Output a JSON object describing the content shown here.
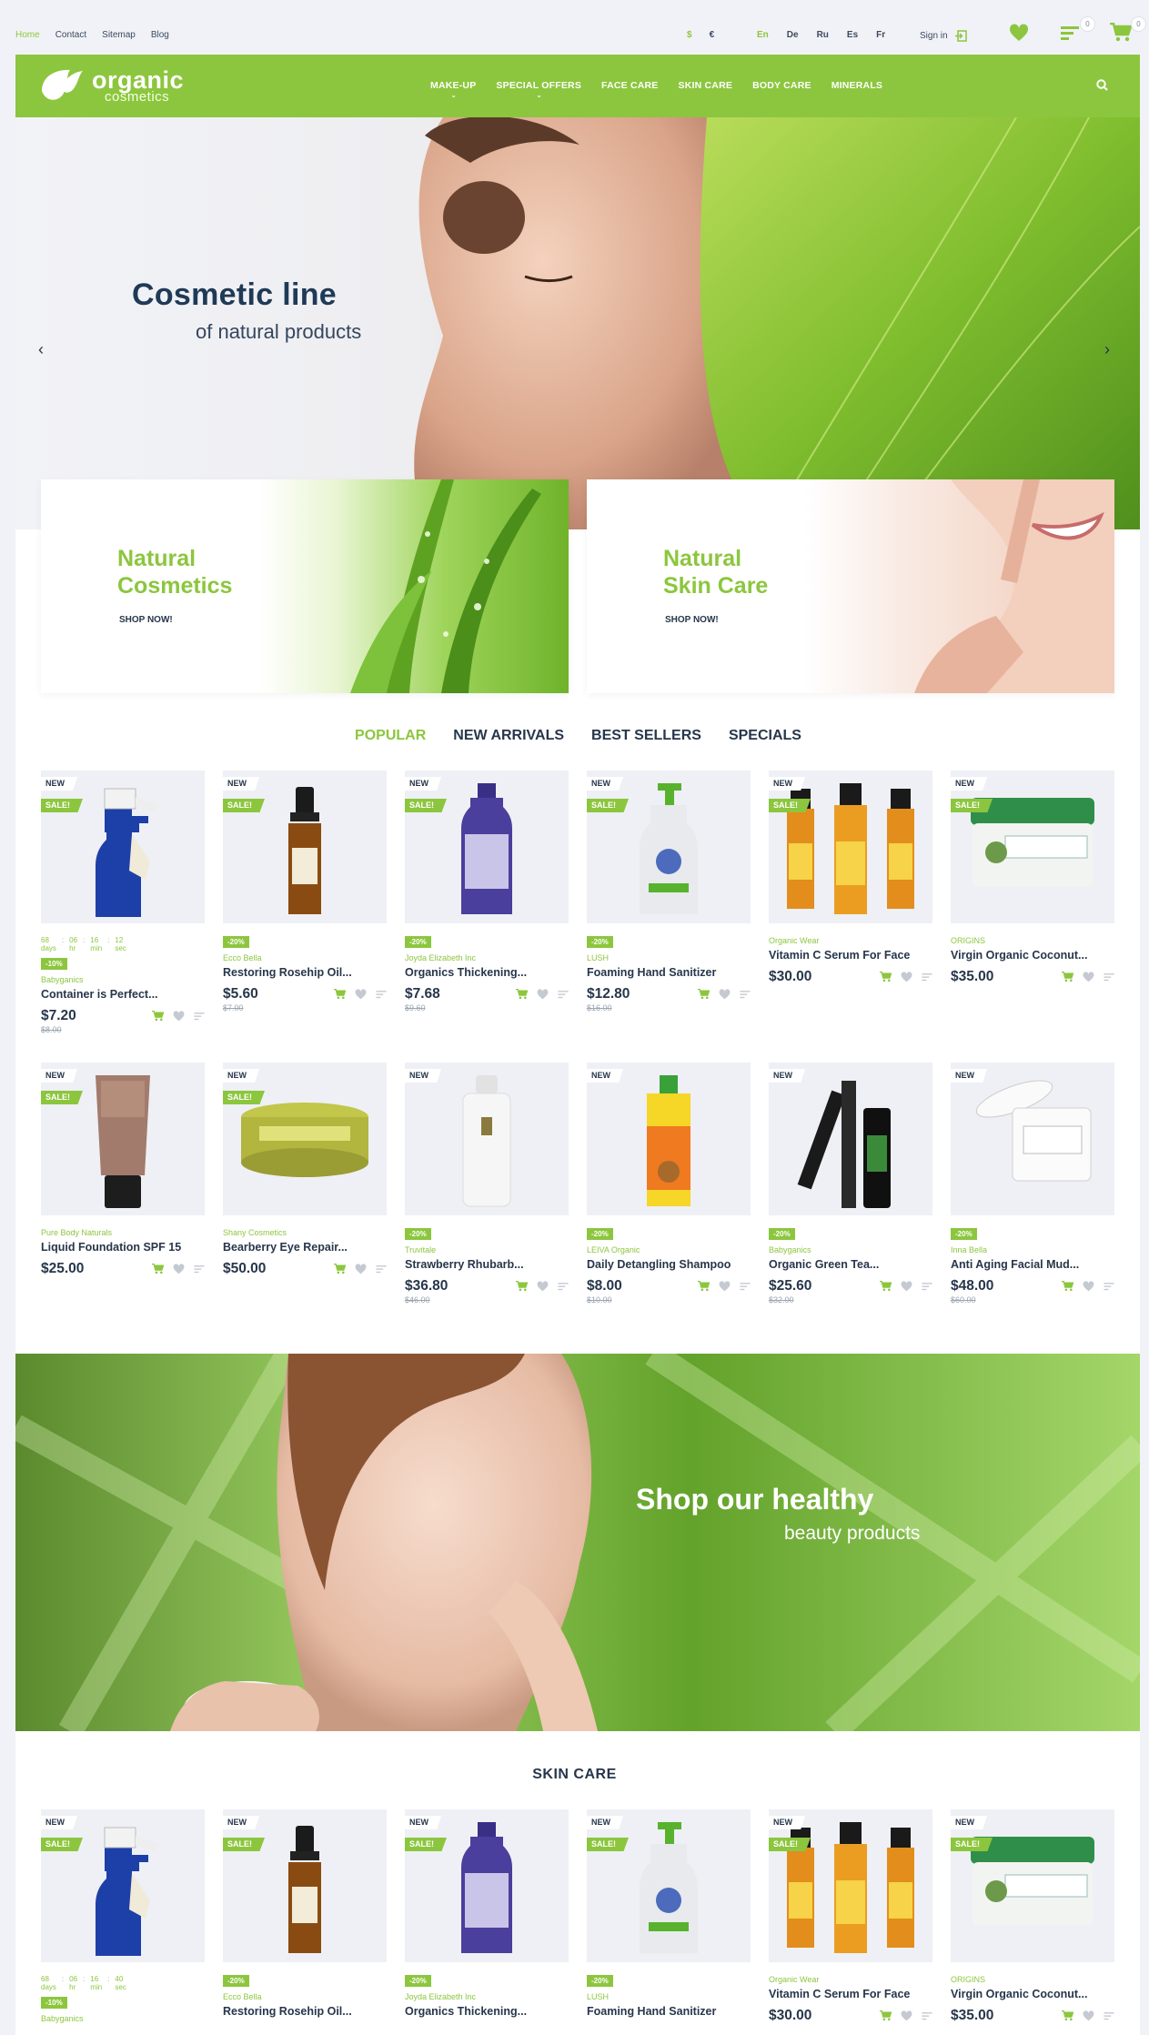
{
  "top_links": [
    "Home",
    "Contact",
    "Sitemap",
    "Blog"
  ],
  "currencies": [
    "$",
    "€"
  ],
  "languages": [
    "En",
    "De",
    "Ru",
    "Es",
    "Fr"
  ],
  "signin": "Sign in",
  "wishlist_count": "",
  "compare_count": "0",
  "cart_count": "0",
  "logo": {
    "line1": "organic",
    "line2": "cosmetics"
  },
  "menu": [
    "MAKE-UP",
    "SPECIAL OFFERS",
    "FACE CARE",
    "SKIN CARE",
    "BODY CARE",
    "MINERALS"
  ],
  "hero": {
    "title": "Cosmetic line",
    "subtitle": "of natural products"
  },
  "banners": [
    {
      "title": "Natural\nCosmetics",
      "cta": "SHOP NOW!"
    },
    {
      "title": "Natural\nSkin Care",
      "cta": "SHOP NOW!"
    }
  ],
  "tabs": [
    "POPULAR",
    "NEW ARRIVALS",
    "BEST SELLERS",
    "SPECIALS"
  ],
  "timer": {
    "days": "68",
    "hours": "06",
    "min": "16",
    "sec": "12",
    "days_label": "days",
    "hours_label": "hr",
    "min_label": "min",
    "sec_label": "sec"
  },
  "timer2": {
    "days": "68",
    "hours": "06",
    "min": "16",
    "sec": "40"
  },
  "products_row1": [
    {
      "brand": "Babyganics",
      "name": "Container is Perfect...",
      "price": "$7.20",
      "old": "$8.00",
      "disc": "-10%",
      "sale": true,
      "timer": true,
      "kind": "spray"
    },
    {
      "brand": "Ecco Bella",
      "name": "Restoring Rosehip Oil...",
      "price": "$5.60",
      "old": "$7.00",
      "disc": "-20%",
      "sale": true,
      "kind": "dropper"
    },
    {
      "brand": "Joyda Elizabeth Inc",
      "name": "Organics Thickening...",
      "price": "$7.68",
      "old": "$9.60",
      "disc": "-20%",
      "sale": true,
      "kind": "shampoo"
    },
    {
      "brand": "LUSH",
      "name": "Foaming Hand Sanitizer",
      "price": "$12.80",
      "old": "$16.00",
      "disc": "-20%",
      "sale": true,
      "kind": "pump"
    },
    {
      "brand": "Organic Wear",
      "name": "Vitamin C Serum For Face",
      "price": "$30.00",
      "old": "",
      "disc": "",
      "sale": true,
      "kind": "serum"
    },
    {
      "brand": "ORIGINS",
      "name": "Virgin Organic Coconut...",
      "price": "$35.00",
      "old": "",
      "disc": "",
      "sale": true,
      "kind": "jar"
    }
  ],
  "products_row2": [
    {
      "brand": "Pure Body Naturals",
      "name": "Liquid Foundation SPF 15",
      "price": "$25.00",
      "old": "",
      "disc": "",
      "sale": true,
      "kind": "tube"
    },
    {
      "brand": "Shany Cosmetics",
      "name": "Bearberry Eye Repair...",
      "price": "$50.00",
      "old": "",
      "disc": "",
      "sale": true,
      "kind": "tin"
    },
    {
      "brand": "Truvitale",
      "name": "Strawberry Rhubarb...",
      "price": "$36.80",
      "old": "$46.00",
      "disc": "-20%",
      "sale": false,
      "kind": "lotion"
    },
    {
      "brand": "LEIVA Organic",
      "name": "Daily Detangling Shampoo",
      "price": "$8.00",
      "old": "$10.00",
      "disc": "-20%",
      "sale": false,
      "kind": "kids"
    },
    {
      "brand": "Babyganics",
      "name": "Organic Green Tea...",
      "price": "$25.60",
      "old": "$32.00",
      "disc": "-20%",
      "sale": false,
      "kind": "mascara"
    },
    {
      "brand": "Inna Bella",
      "name": "Anti Aging Facial Mud...",
      "price": "$48.00",
      "old": "$60.00",
      "disc": "-20%",
      "sale": false,
      "kind": "whitejar"
    }
  ],
  "badges": {
    "new": "NEW",
    "sale": "SALE!"
  },
  "promo": {
    "title": "Shop our healthy",
    "subtitle": "beauty products"
  },
  "section_title": "SKIN CARE",
  "products_row3": [
    {
      "brand": "Babyganics",
      "name": "",
      "price": "",
      "old": "",
      "disc": "-10%",
      "sale": true,
      "timer": true,
      "kind": "spray"
    },
    {
      "brand": "Ecco Bella",
      "name": "Restoring Rosehip Oil...",
      "price": "",
      "old": "",
      "disc": "-20%",
      "sale": true,
      "kind": "dropper"
    },
    {
      "brand": "Joyda Elizabeth Inc",
      "name": "Organics Thickening...",
      "price": "",
      "old": "",
      "disc": "-20%",
      "sale": true,
      "kind": "shampoo"
    },
    {
      "brand": "LUSH",
      "name": "Foaming Hand Sanitizer",
      "price": "",
      "old": "",
      "disc": "-20%",
      "sale": true,
      "kind": "pump"
    },
    {
      "brand": "Organic Wear",
      "name": "Vitamin C Serum For Face",
      "price": "$30.00",
      "old": "",
      "disc": "",
      "sale": true,
      "kind": "serum"
    },
    {
      "brand": "ORIGINS",
      "name": "Virgin Organic Coconut...",
      "price": "$35.00",
      "old": "",
      "disc": "",
      "sale": true,
      "kind": "jar"
    }
  ],
  "colors": {
    "accent": "#8cc63e",
    "text": "#27364b",
    "page_bg": "#f1f2f7"
  }
}
